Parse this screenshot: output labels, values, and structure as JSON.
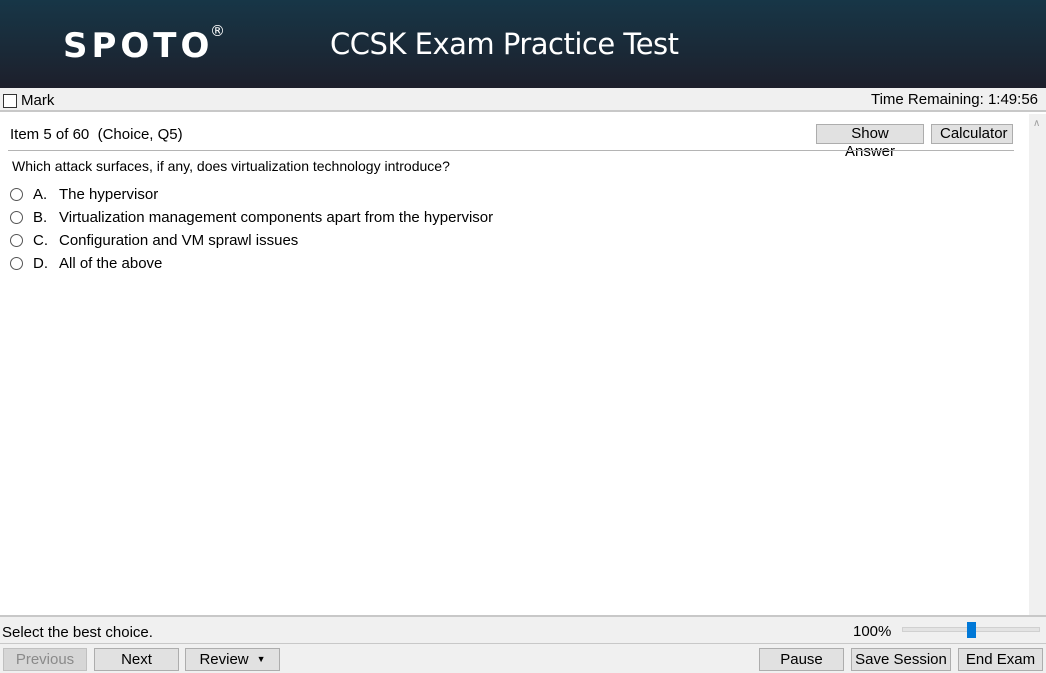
{
  "header": {
    "logo": "SPOTO",
    "logo_mark": "®",
    "title": "CCSK Exam Practice Test",
    "colors": {
      "gradient_top": "#173647",
      "gradient_bottom": "#1d1f2b"
    }
  },
  "markbar": {
    "mark_label": "Mark",
    "mark_checked": false,
    "time_remaining": "Time Remaining: 1:49:56"
  },
  "item": {
    "prefix": "Item",
    "current": "5",
    "of": "of",
    "total": "60",
    "meta": "(Choice, Q5)",
    "show_answer_label": "Show Answer",
    "calculator_label": "Calculator"
  },
  "question": {
    "text": "Which attack surfaces, if any, does virtualization technology introduce?",
    "options": [
      {
        "letter": "A.",
        "text": "The hypervisor",
        "selected": false
      },
      {
        "letter": "B.",
        "text": "Virtualization management components apart from the hypervisor",
        "selected": false
      },
      {
        "letter": "C.",
        "text": "Configuration and VM sprawl issues",
        "selected": false
      },
      {
        "letter": "D.",
        "text": "All of the above",
        "selected": false
      }
    ]
  },
  "scrollbar": {
    "up_icon": "chevron-up-icon"
  },
  "status": {
    "instruction": "Select the best choice.",
    "zoom_label": "100%",
    "zoom_slider_fraction": 0.5,
    "accent_color": "#0078d7"
  },
  "nav": {
    "previous_label": "Previous",
    "previous_disabled": true,
    "next_label": "Next",
    "review_label": "Review",
    "review_caret": "▼",
    "pause_label": "Pause",
    "save_session_label": "Save Session",
    "end_exam_label": "End Exam"
  }
}
